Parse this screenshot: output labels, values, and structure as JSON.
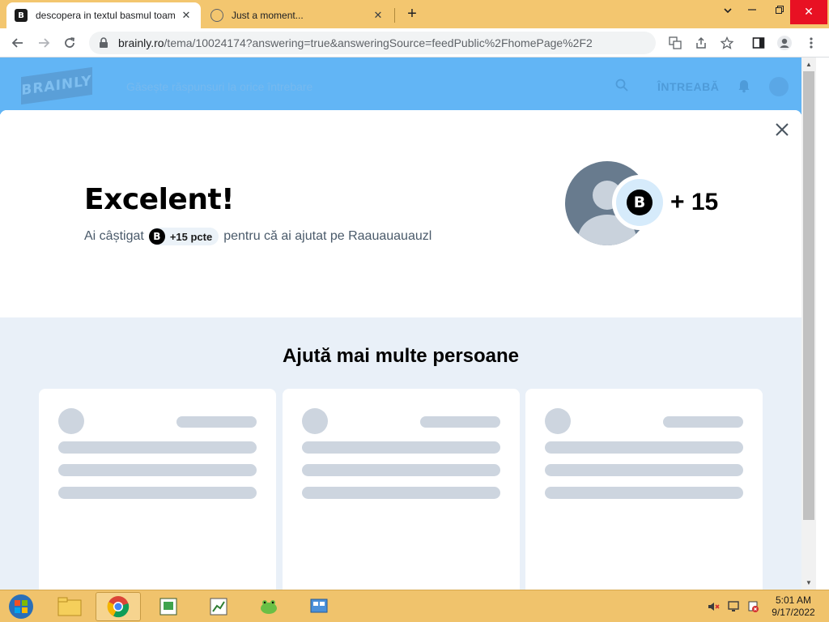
{
  "browser": {
    "tabs": [
      {
        "title": "descopera in textul basmul toam",
        "active": true,
        "favicon": "brainly-icon"
      },
      {
        "title": "Just a moment...",
        "active": false,
        "favicon": "globe-icon"
      }
    ],
    "new_tab_label": "+",
    "url_host": "brainly.ro",
    "url_rest": "/tema/10024174?answering=true&answeringSource=feedPublic%2FhomePage%2F2"
  },
  "brainly_header": {
    "logo": "BRAINLY",
    "search_placeholder": "Găsește răspunsuri la orice întrebare",
    "ask_label": "ÎNTREABĂ"
  },
  "modal": {
    "headline": "Excelent!",
    "earned_prefix": "Ai câștigat",
    "points_badge": "+15 pcte",
    "earned_suffix": "pentru că ai ajutat pe Raauauauauzl",
    "coin_letter": "B",
    "points_award": "+ 15",
    "section_title": "Ajută mai multe persoane"
  },
  "taskbar": {
    "clock_time": "5:01 AM",
    "clock_date": "9/17/2022"
  },
  "colors": {
    "tab_strip": "#f3c66f",
    "brainly_header": "#62b5f5",
    "modal_bg": "#e9f0f8",
    "skeleton": "#cdd5df",
    "close_button": "#e81123"
  }
}
